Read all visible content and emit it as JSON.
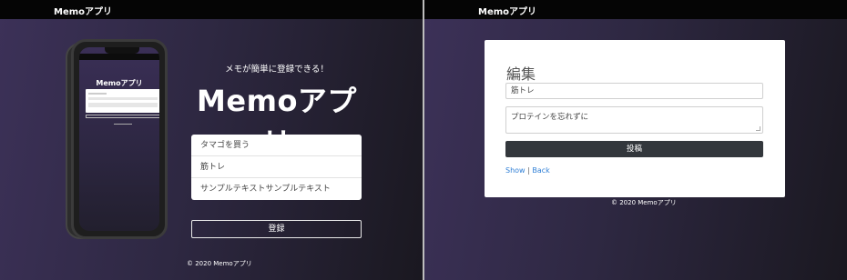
{
  "brand": "Memoアプリ",
  "home": {
    "tagline": "メモが簡単に登録できる！",
    "hero_title": "Memoアプリ",
    "memos": [
      "タマゴを買う",
      "筋トレ",
      "サンプルテキストサンプルテキスト"
    ],
    "register_label": "登録",
    "footer": "© 2020 Memoアプリ"
  },
  "edit": {
    "heading": "編集",
    "title_value": "筋トレ",
    "body_value": "プロテインを忘れずに",
    "submit_label": "投稿",
    "show_link": "Show",
    "separator": " | ",
    "back_link": "Back",
    "footer": "© 2020 Memoアプリ"
  },
  "colors": {
    "navbar": "#050505",
    "background_gradient_start": "#3c3158",
    "background_gradient_end": "#1a1820",
    "submit_button": "#33373c",
    "link": "#2f7fd6"
  },
  "icons": [
    "phone-mockup-image",
    "textarea-resize-icon"
  ]
}
